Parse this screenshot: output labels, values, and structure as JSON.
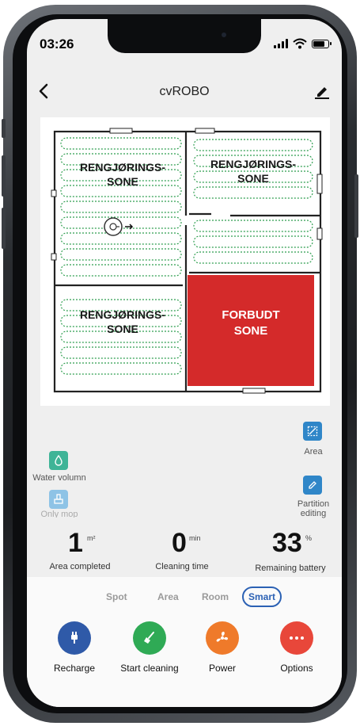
{
  "status_bar": {
    "time": "03:26"
  },
  "header": {
    "title": "cvROBO"
  },
  "map": {
    "zones": [
      {
        "label": "RENGJØRINGS-\nSONE"
      },
      {
        "label": "RENGJØRINGS-\nSONE"
      },
      {
        "label": "RENGJØRINGS-\nSONE"
      },
      {
        "label": "FORBUDT\nSONE"
      }
    ],
    "colors": {
      "forbidden": "#d42a2a",
      "path": "#2e9e4f",
      "walls": "#222222"
    }
  },
  "controls": {
    "water_volume": "Water volumn",
    "only_mop": "Only mop",
    "area": "Area",
    "partition_editing": "Partition editing"
  },
  "stats": {
    "area_value": "1",
    "area_unit": "m²",
    "area_label": "Area completed",
    "time_value": "0",
    "time_unit": "min",
    "time_label": "Cleaning time",
    "battery_value": "33",
    "battery_unit": "%",
    "battery_label": "Remaining battery"
  },
  "modes": {
    "spot": "Spot",
    "area": "Area",
    "room": "Room",
    "smart": "Smart",
    "selected": "Smart"
  },
  "actions": {
    "recharge": "Recharge",
    "start": "Start cleaning",
    "power": "Power",
    "options": "Options"
  },
  "colors": {
    "recharge": "#2f5aa8",
    "start": "#2faa55",
    "power": "#ef7a2a",
    "options": "#e8473a",
    "accent": "#2b61b4"
  }
}
